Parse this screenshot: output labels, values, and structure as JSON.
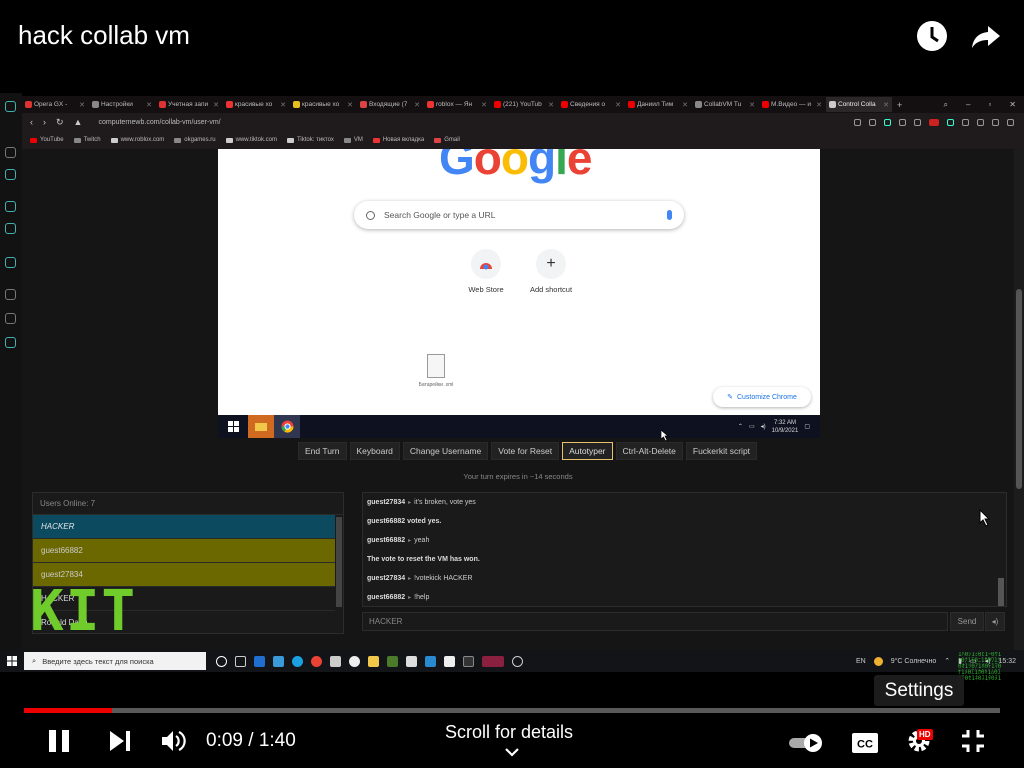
{
  "video": {
    "title": "hack collab vm",
    "current_time": "0:09",
    "separator": " / ",
    "duration": "1:40",
    "progress_fraction": 0.09,
    "scroll_hint": "Scroll for details",
    "tooltip": "Settings",
    "hd_badge": "HD",
    "watermark": "KIT"
  },
  "browser": {
    "tabs": [
      {
        "label": "Opera GX - ",
        "color": "#d33"
      },
      {
        "label": "Настройки",
        "color": "#888"
      },
      {
        "label": "Учетная запи",
        "color": "#d33"
      },
      {
        "label": "красивые хо",
        "color": "#e33"
      },
      {
        "label": "красивые хо",
        "color": "#e6c020"
      },
      {
        "label": "Входящие (7",
        "color": "#d44"
      },
      {
        "label": "roblox — Ян",
        "color": "#e33"
      },
      {
        "label": "(221) YouTub",
        "color": "#e00"
      },
      {
        "label": "Сведения о",
        "color": "#e00"
      },
      {
        "label": "Даниил Тим",
        "color": "#e00"
      },
      {
        "label": "CollabVM Tu",
        "color": "#888"
      },
      {
        "label": "M.Видео — и",
        "color": "#e00"
      },
      {
        "label": "Control Colla",
        "color": "#ccc"
      }
    ],
    "url": "computernewb.com/collab-vm/user-vm/",
    "bookmarks": [
      {
        "label": "YouTube",
        "color": "#e00"
      },
      {
        "label": "Twitch",
        "color": "#888"
      },
      {
        "label": "www.roblox.com",
        "color": "#ccc"
      },
      {
        "label": "okgames.ru",
        "color": "#888"
      },
      {
        "label": "www.tiktok.com",
        "color": "#ccc"
      },
      {
        "label": "Tiktok: тиктох",
        "color": "#ccc"
      },
      {
        "label": "VM",
        "color": "#888"
      },
      {
        "label": "Новая вкладка",
        "color": "#e33"
      },
      {
        "label": "Gmail",
        "color": "#d44"
      }
    ]
  },
  "vm_screen": {
    "search_placeholder": "Search Google or type a URL",
    "shortcuts": [
      {
        "label": "Web Store",
        "icon": "web-store-icon"
      },
      {
        "label": "Add shortcut",
        "icon": "plus-icon",
        "glyph": "+"
      }
    ],
    "desktop_file": "Батарейки\n.xml",
    "customize_label": "Customize Chrome",
    "clock_time": "7:32 AM",
    "clock_date": "10/9/2021"
  },
  "vm_controls": {
    "buttons": [
      "End Turn",
      "Keyboard",
      "Change Username",
      "Vote for Reset",
      "Autotyper",
      "Ctrl-Alt-Delete",
      "Fuckerkit script"
    ],
    "active_button": "Autotyper",
    "turn_text": "Your turn expires in ~14 seconds"
  },
  "users": {
    "header": "Users Online: 7",
    "list": [
      {
        "name": "HACKER",
        "style": "me"
      },
      {
        "name": "guest66882",
        "style": "olive"
      },
      {
        "name": "guest27834",
        "style": "olive"
      },
      {
        "name": "HACKER",
        "style": "plain"
      },
      {
        "name": "Ronald Daria",
        "style": "plain"
      }
    ]
  },
  "chat": {
    "messages": [
      {
        "user": "guest27834",
        "text": "it's broken, vote yes"
      },
      {
        "user": "",
        "text": "guest66882 voted yes."
      },
      {
        "user": "guest66882",
        "text": "yeah"
      },
      {
        "user": "",
        "text": "The vote to reset the VM has won."
      },
      {
        "user": "guest27834",
        "text": "!votekick HACKER"
      },
      {
        "user": "guest66882",
        "text": "!help"
      }
    ],
    "input_value": "HACKER",
    "send_label": "Send"
  },
  "host_taskbar": {
    "search_placeholder": "Введите здесь текст для поиска",
    "lang": "EN",
    "weather": "9°C  Солнечно",
    "time": "15:32"
  },
  "colors": {
    "progress_played": "#e00",
    "active_button_border": "#e7c26a",
    "me_row": "#0c4a60",
    "olive_row": "#6b6800",
    "watermark": "#6fcc2a"
  }
}
